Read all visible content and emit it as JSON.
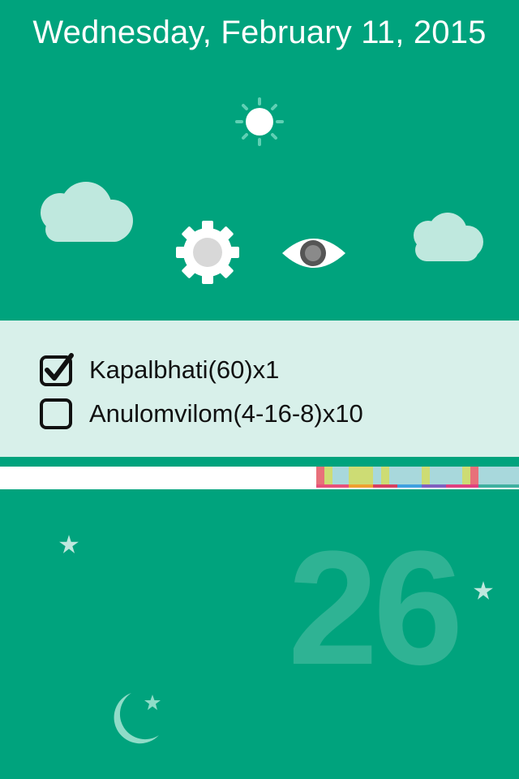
{
  "header": {
    "date": "Wednesday, February 11, 2015"
  },
  "icons": {
    "sun": "sun-icon",
    "cloud_left": "cloud-icon",
    "cloud_right": "cloud-icon",
    "gear": "gear-icon",
    "eye": "eye-icon",
    "star": "star-icon",
    "moon": "moon-icon"
  },
  "tasks": [
    {
      "label": "Kapalbhati(60)x1",
      "checked": true
    },
    {
      "label": "Anulomvilom(4-16-8)x10",
      "checked": false
    }
  ],
  "counter": {
    "value": "26"
  },
  "colors": {
    "background": "#00a37d",
    "panel": "#d8f0ea",
    "cloud": "#bfe8de",
    "number": "#2fb394"
  }
}
